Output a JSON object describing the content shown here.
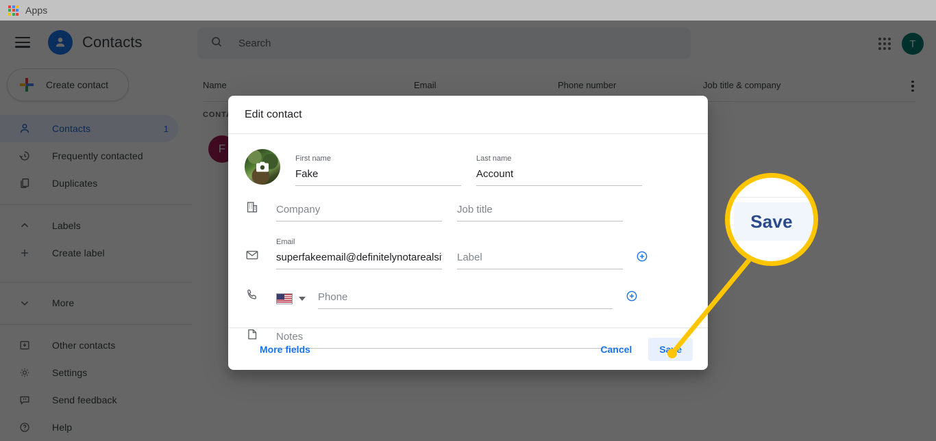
{
  "browser": {
    "apps_label": "Apps",
    "apps_icon": "apps-grid-icon"
  },
  "app": {
    "brand_title": "Contacts",
    "menu_icon": "hamburger-icon",
    "logo_icon": "person-avatar-icon"
  },
  "sidebar": {
    "create_contact_label": "Create contact",
    "create_contact_icon": "plus-icon",
    "items": [
      {
        "label": "Contacts",
        "icon": "person-icon",
        "count": "1",
        "active": true
      },
      {
        "label": "Frequently contacted",
        "icon": "history-icon",
        "count": "",
        "active": false
      },
      {
        "label": "Duplicates",
        "icon": "copy-icon",
        "count": "",
        "active": false
      },
      {
        "label": "Labels",
        "icon": "chevron-up-icon",
        "count": "",
        "active": false
      },
      {
        "label": "Create label",
        "icon": "plus-icon",
        "count": "",
        "active": false
      },
      {
        "label": "More",
        "icon": "chevron-down-icon",
        "count": "",
        "active": false
      },
      {
        "label": "Other contacts",
        "icon": "archive-icon",
        "count": "",
        "active": false
      },
      {
        "label": "Settings",
        "icon": "gear-icon",
        "count": "",
        "active": false
      },
      {
        "label": "Send feedback",
        "icon": "feedback-icon",
        "count": "",
        "active": false
      },
      {
        "label": "Help",
        "icon": "help-icon",
        "count": "",
        "active": false
      }
    ]
  },
  "topbar": {
    "search_placeholder": "Search",
    "search_icon": "search-icon",
    "apps_grid_icon": "google-apps-icon",
    "account_initial": "T",
    "account_color": "#00796b"
  },
  "list": {
    "columns": [
      "Name",
      "Email",
      "Phone number",
      "Job title & company"
    ],
    "overflow_icon": "kebab-menu-icon",
    "section_label": "CONTACTS",
    "rows": [
      {
        "initial": "F",
        "avatar_color": "#a52056"
      }
    ]
  },
  "dialog": {
    "title": "Edit contact",
    "photo_icon": "camera-icon",
    "fields": {
      "first_name": {
        "label": "First name",
        "value": "Fake",
        "placeholder": "First name"
      },
      "last_name": {
        "label": "Last name",
        "value": "Account",
        "placeholder": "Last name"
      },
      "company": {
        "label": "",
        "value": "",
        "placeholder": "Company",
        "icon": "building-icon"
      },
      "job_title": {
        "label": "",
        "value": "",
        "placeholder": "Job title"
      },
      "email": {
        "label": "Email",
        "value": "superfakeemail@definitelynotarealsite",
        "placeholder": "Email",
        "icon": "envelope-icon"
      },
      "email_label": {
        "label": "",
        "value": "",
        "placeholder": "Label"
      },
      "phone": {
        "label": "",
        "value": "",
        "placeholder": "Phone",
        "icon": "phone-icon",
        "country": "US"
      },
      "notes": {
        "label": "",
        "value": "",
        "placeholder": "Notes",
        "icon": "note-icon"
      }
    },
    "add_email_icon": "add-circle-icon",
    "add_phone_icon": "add-circle-icon",
    "footer": {
      "more_fields": "More fields",
      "cancel": "Cancel",
      "save": "Save"
    }
  },
  "annotation": {
    "magnified_label": "Save",
    "highlight_color": "#ffc600"
  }
}
